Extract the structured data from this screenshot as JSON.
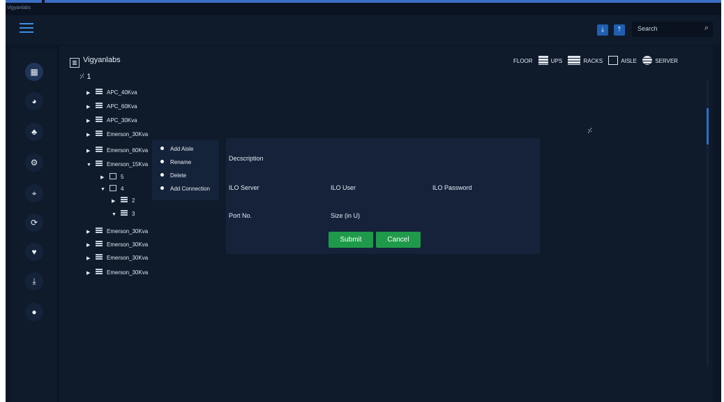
{
  "app": {
    "logo_text": "Vigyanlabs"
  },
  "header": {
    "search_placeholder": "Search",
    "download_icon": "download-icon",
    "upload_icon": "upload-icon"
  },
  "sidebar": {
    "items": [
      {
        "name": "dashboard",
        "icon": "grid-icon",
        "active": true
      },
      {
        "name": "analytics",
        "icon": "pie-chart-icon"
      },
      {
        "name": "hierarchy",
        "icon": "sitemap-icon"
      },
      {
        "name": "settings-sync",
        "icon": "gear-sync-icon"
      },
      {
        "name": "map",
        "icon": "map-icon"
      },
      {
        "name": "refresh",
        "icon": "refresh-icon"
      },
      {
        "name": "health",
        "icon": "heart-pulse-icon"
      },
      {
        "name": "download",
        "icon": "download-icon"
      },
      {
        "name": "user",
        "icon": "user-circle-icon"
      }
    ]
  },
  "tree": {
    "root": "Vigyanlabs",
    "floor": "1",
    "nodes": [
      {
        "label": "APC_40Kva",
        "arrow": "▶",
        "icon": "ups"
      },
      {
        "label": "APC_60Kva",
        "arrow": "▶",
        "icon": "ups"
      },
      {
        "label": "APC_30Kva",
        "arrow": "▶",
        "icon": "ups"
      },
      {
        "label": "Emerson_30Kva",
        "arrow": "▶",
        "icon": "ups"
      },
      {
        "label": "Emerson_60Kva",
        "arrow": "▶",
        "icon": "ups"
      },
      {
        "label": "Emerson_15Kva",
        "arrow": "▼",
        "icon": "ups"
      },
      {
        "label": "5",
        "arrow": "▶",
        "icon": "aisle"
      },
      {
        "label": "4",
        "arrow": "▼",
        "icon": "aisle"
      },
      {
        "label": "2",
        "arrow": "▶",
        "icon": "rack"
      },
      {
        "label": "3",
        "arrow": "▼",
        "icon": "rack"
      },
      {
        "label": "Emerson_30Kva",
        "arrow": "▶",
        "icon": "ups"
      },
      {
        "label": "Emerson_30Kva",
        "arrow": "▶",
        "icon": "ups"
      },
      {
        "label": "Emerson_30Kva",
        "arrow": "▶",
        "icon": "ups"
      },
      {
        "label": "Emerson_30Kva",
        "arrow": "▶",
        "icon": "ups"
      }
    ]
  },
  "legend": {
    "floor": "FLOOR",
    "ups": "UPS",
    "racks": "RACKS",
    "aisle": "AISLE",
    "server": "SERVER"
  },
  "context_menu": {
    "items": [
      "Add Aisle",
      "Rename",
      "Delete",
      "Add Connection"
    ]
  },
  "form": {
    "description": "Decscription",
    "ilo_server": "ILO Server",
    "ilo_user": "ILO User",
    "ilo_password": "ILO Password",
    "port_no": "Port No.",
    "size": "Size (in U)",
    "submit": "Submit",
    "cancel": "Cancel"
  },
  "colors": {
    "background": "#0d1626",
    "panel": "#0f1a2b",
    "accent": "#3b6fc4",
    "button_green": "#1f9a4a"
  }
}
